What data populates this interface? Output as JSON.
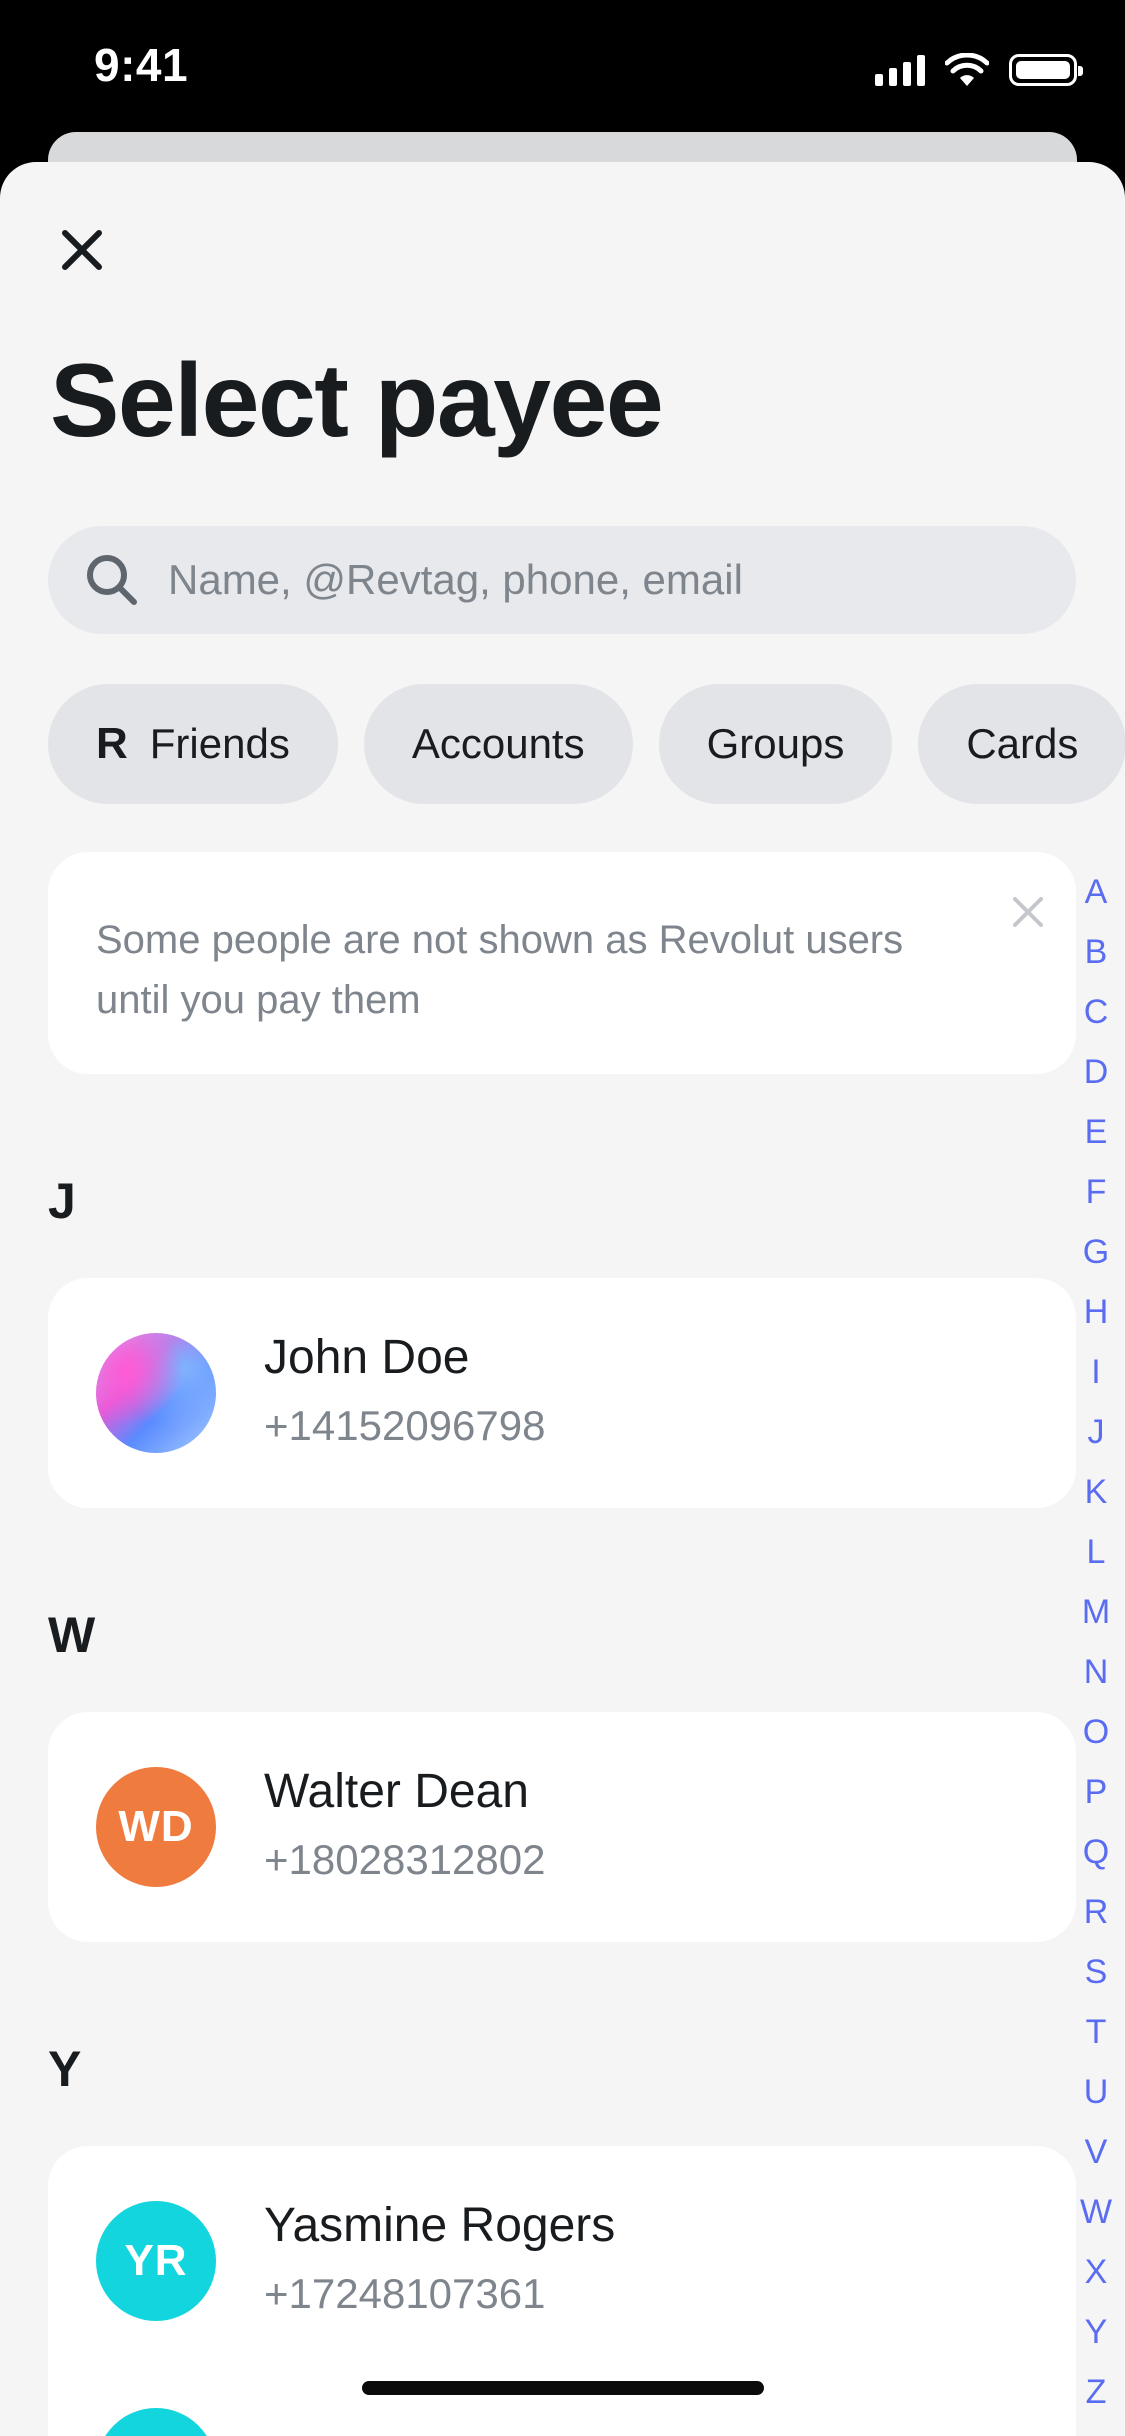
{
  "status_bar": {
    "time": "9:41"
  },
  "header": {
    "title": "Select payee"
  },
  "search": {
    "placeholder": "Name, @Revtag, phone, email"
  },
  "filters": [
    {
      "label": "Friends",
      "icon": "revolut-r-logo"
    },
    {
      "label": "Accounts"
    },
    {
      "label": "Groups"
    },
    {
      "label": "Cards"
    }
  ],
  "banner": {
    "text": "Some people are not shown as Revolut users until you pay them"
  },
  "sections": [
    {
      "letter": "J",
      "contacts": [
        {
          "name": "John Doe",
          "phone": "+14152096798",
          "avatar": "gradient",
          "initials": ""
        }
      ]
    },
    {
      "letter": "W",
      "contacts": [
        {
          "name": "Walter Dean",
          "phone": "+18028312802",
          "initials": "WD",
          "avatar_color": "#f07b3f"
        }
      ]
    },
    {
      "letter": "Y",
      "contacts": [
        {
          "name": "Yasmine Rogers",
          "phone": "+17248107361",
          "initials": "YR",
          "avatar_color": "#12d5de"
        }
      ]
    }
  ],
  "alphabet_index": [
    "A",
    "B",
    "C",
    "D",
    "E",
    "F",
    "G",
    "H",
    "I",
    "J",
    "K",
    "L",
    "M",
    "N",
    "O",
    "P",
    "Q",
    "R",
    "S",
    "T",
    "U",
    "V",
    "W",
    "X",
    "Y",
    "Z",
    "#"
  ],
  "colors": {
    "accent": "#5a6cf0",
    "text_primary": "#191c1f",
    "text_secondary": "#7f858d",
    "background": "#f5f5f6"
  }
}
